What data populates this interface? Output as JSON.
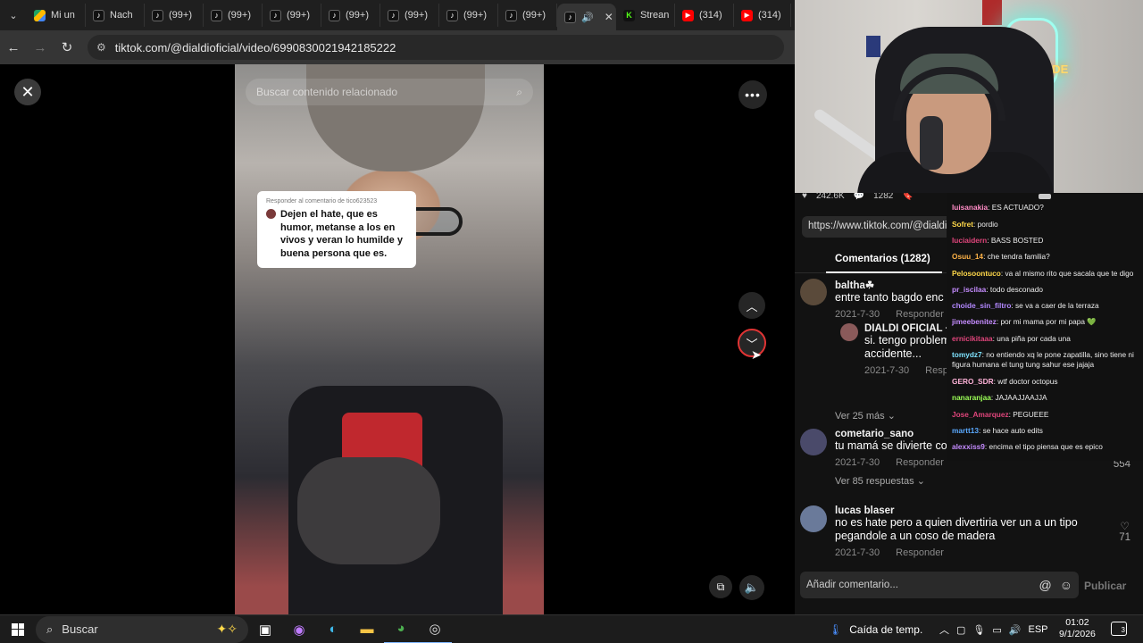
{
  "browser": {
    "tabs": [
      {
        "favicon": "drive",
        "label": "Mi un"
      },
      {
        "favicon": "tiktok",
        "label": "Nach"
      },
      {
        "favicon": "tiktok",
        "label": "(99+)"
      },
      {
        "favicon": "tiktok",
        "label": "(99+)"
      },
      {
        "favicon": "tiktok",
        "label": "(99+)"
      },
      {
        "favicon": "tiktok",
        "label": "(99+)"
      },
      {
        "favicon": "tiktok",
        "label": "(99+)"
      },
      {
        "favicon": "tiktok",
        "label": "(99+)"
      },
      {
        "favicon": "tiktok",
        "label": "(99+)"
      },
      {
        "favicon": "tiktok",
        "label": "",
        "active": true
      },
      {
        "favicon": "kick",
        "label": "Strean"
      },
      {
        "favicon": "youtube",
        "label": "(314)"
      },
      {
        "favicon": "youtube",
        "label": "(314)"
      }
    ],
    "url": "tiktok.com/@dialdioficial/video/6990830021942185222"
  },
  "video": {
    "search_placeholder": "Buscar contenido relacionado",
    "reply_header": "Responder al comentario de tico623523",
    "reply_quote": "Dejen el hate, que es humor, metanse a los en vivos y veran lo humilde y buena persona que es."
  },
  "stats": {
    "likes": "242.6K",
    "comments": "1282"
  },
  "copy_link": "https://www.tiktok.com/@dialdi",
  "comments_tab": "Comentarios (1282)",
  "comments": [
    {
      "user": "baltha☘",
      "text": "entre tanto bagdo enc",
      "date": "2021-7-30",
      "reply": "Responder",
      "sub": {
        "user": "DIALDI OFICIAL · C",
        "text1": "si. tengo problem",
        "text2": "accidente...",
        "date": "2021-7-30",
        "reply": "Respo"
      },
      "more": "Ver 25 más"
    },
    {
      "user": "cometario_sano",
      "text": "tu mamá se divierte co",
      "date": "2021-7-30",
      "reply": "Responder",
      "likes": "554",
      "more": "Ver 85 respuestas"
    },
    {
      "user": "lucas blaser",
      "text1": "no es hate pero a quien divertiria ver un a un tipo",
      "text2": "pegandole a un coso de madera",
      "date": "2021-7-30",
      "reply": "Responder",
      "likes": "71"
    }
  ],
  "add_comment_placeholder": "Añadir comentario...",
  "publish_label": "Publicar",
  "webcam": {
    "neon_text": "NACHOIDE"
  },
  "chat": [
    {
      "user": "luisanakia",
      "color": "#ff8cc6",
      "msg": "ES ACTUADO?"
    },
    {
      "user": "Sofret",
      "color": "#ffd84a",
      "msg": "pordio"
    },
    {
      "user": "luciaidern",
      "color": "#e0457b",
      "msg": "BASS BOSTED"
    },
    {
      "user": "Osuu_14",
      "color": "#ffb347",
      "msg": "che tendra familia?"
    },
    {
      "user": "Pelosoontuco",
      "color": "#ffd84a",
      "msg": "va al mismo rito que sacala que te digo"
    },
    {
      "user": "pr_iscilaa",
      "color": "#c58cff",
      "msg": "todo desconado"
    },
    {
      "user": "choide_sin_filtro",
      "color": "#b388ff",
      "msg": "se va a caer de la terraza"
    },
    {
      "user": "jimeebenitez",
      "color": "#c58cff",
      "msg": "por mi mama por mi papa 💚"
    },
    {
      "user": "ernicikitaaa",
      "color": "#e0457b",
      "msg": "una piña por cada una"
    },
    {
      "user": "tomydz7",
      "color": "#7fe3ff",
      "msg": "no entiendo xq le pone zapatilla, sino tiene ni figura humana el tung tung sahur ese jajaja"
    },
    {
      "user": "GERO_SDR",
      "color": "#ffb3d9",
      "msg": "wtf doctor octopus"
    },
    {
      "user": "nanaranjaa",
      "color": "#9cff57",
      "msg": "JAJAAJJAAJJA"
    },
    {
      "user": "Jose_Amarquez",
      "color": "#e0457b",
      "msg": "PEGUEEE"
    },
    {
      "user": "martt13",
      "color": "#5aa9ff",
      "msg": "se hace auto edits"
    },
    {
      "user": "alexxiss9",
      "color": "#c58cff",
      "msg": "encima el tipo piensa que es epico"
    }
  ],
  "taskbar": {
    "search_label": "Buscar",
    "weather": "Caída de temp.",
    "lang": "ESP",
    "time": "01:02",
    "date": "9/1/2026",
    "notif_count": "3"
  }
}
